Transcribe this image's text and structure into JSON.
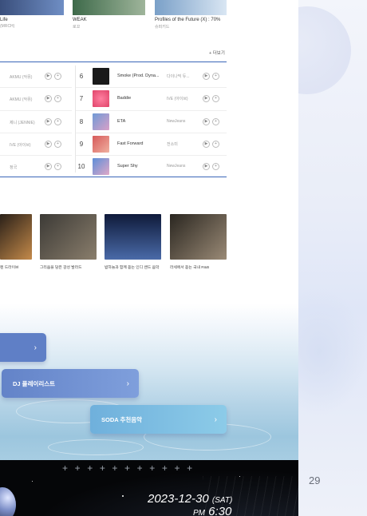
{
  "albums": [
    {
      "title": "Life",
      "artist": "(MRCH)",
      "color_a": "#3a4f7c",
      "color_b": "#6f8ec4"
    },
    {
      "title": "WEAK",
      "artist": "로꼬",
      "color_a": "#3e6a4a",
      "color_b": "#9fb59b"
    },
    {
      "title": "Profiles of the Future (X) : 70%",
      "artist": "슈퍼키드",
      "color_a": "#7aa0c8",
      "color_b": "#d9e6f3"
    }
  ],
  "chart": {
    "more_label": "+ 더보기",
    "left_rows": [
      {
        "artist": "AKMU (악뮤)"
      },
      {
        "artist": "AKMU (악뮤)"
      },
      {
        "artist": "제니 (JENNIE)"
      },
      {
        "artist": "IVE (아이브)"
      },
      {
        "artist": "정국"
      }
    ],
    "right_rows": [
      {
        "rank": "6",
        "title": "Smoke (Prod. Dyna...",
        "artist": "다이나믹 듀...",
        "thumb_color": "#1a1a1a"
      },
      {
        "rank": "7",
        "title": "Baddie",
        "artist": "IVE (아이브)",
        "thumb_color": "#e0446a"
      },
      {
        "rank": "8",
        "title": "ETA",
        "artist": "NewJeans",
        "thumb_color": "#6f9ad6"
      },
      {
        "rank": "9",
        "title": "Fast Forward",
        "artist": "전소미",
        "thumb_color": "#d65a5a"
      },
      {
        "rank": "10",
        "title": "Super Shy",
        "artist": "NewJeans",
        "thumb_color": "#5c8ed8"
      }
    ],
    "play_icon": "▶",
    "add_icon": "+"
  },
  "playlists": [
    {
      "caption": "렌 드라이브",
      "color_a": "#2a2018",
      "color_b": "#c48a4a"
    },
    {
      "caption": "그리움을 담은 감성 발라드",
      "color_a": "#3c3a36",
      "color_b": "#8a7e6c"
    },
    {
      "caption": "밤하늘과 함께 듣는 인디 밴드 음악",
      "color_a": "#0f1a3a",
      "color_b": "#4a6aa8"
    },
    {
      "caption": "라세에서 듣는 국내 R&B",
      "color_a": "#2a2620",
      "color_b": "#9a8a76"
    }
  ],
  "menu": {
    "first": {
      "label": "",
      "color": "#5f7fc6"
    },
    "dj": {
      "label": "DJ 플레이리스트",
      "color": "#6d8fd0"
    },
    "soda": {
      "label": "SODA 추천음악",
      "color": "#78b8de"
    },
    "chevron": "›"
  },
  "event": {
    "plus_marks": "+++++++++++",
    "date": "2023-12-30",
    "day": "(SAT)",
    "time_prefix": "PM",
    "time": "6:30"
  },
  "page_number": "29"
}
